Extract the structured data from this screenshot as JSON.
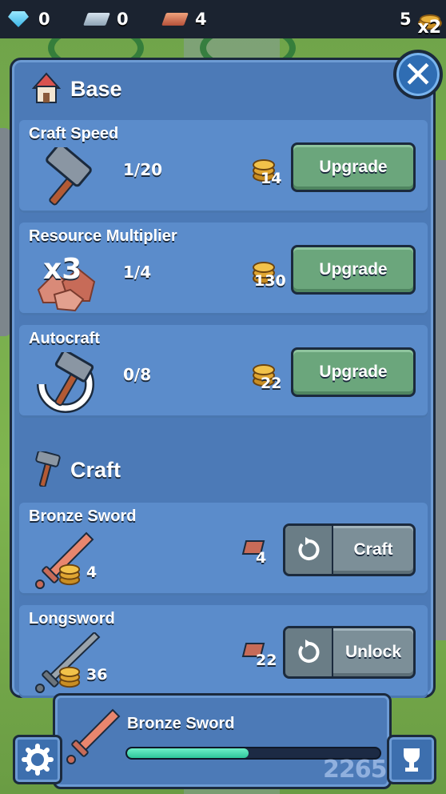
{
  "resources": {
    "gems": "0",
    "iron": "0",
    "copper": "4",
    "coins": "5",
    "multiplier": "x2"
  },
  "base": {
    "title": "Base",
    "upgrades": [
      {
        "name": "Craft Speed",
        "level": "1/20",
        "cost": "14",
        "button": "Upgrade",
        "icon": "hammer-icon"
      },
      {
        "name": "Resource Multiplier",
        "level": "1/4",
        "cost": "130",
        "button": "Upgrade",
        "icon": "ore-x3-icon",
        "art_label": "x3"
      },
      {
        "name": "Autocraft",
        "level": "0/8",
        "cost": "22",
        "button": "Upgrade",
        "icon": "autocraft-icon"
      }
    ]
  },
  "craft": {
    "title": "Craft",
    "items": [
      {
        "name": "Bronze Sword",
        "value": "4",
        "ore_cost": "4",
        "button": "Craft",
        "icon": "bronze-sword-icon"
      },
      {
        "name": "Longsword",
        "value": "36",
        "ore_cost": "22",
        "button": "Unlock",
        "icon": "longsword-icon"
      }
    ]
  },
  "current_craft": {
    "name": "Bronze Sword",
    "progress": 0.48
  },
  "colors": {
    "panel": "#4c7ab7",
    "card": "#5b8ccb",
    "upgrade_button": "#6ba67c",
    "craft_button": "#7c8f98",
    "progress_fill": "#2ec79b"
  },
  "watermark": "2265"
}
